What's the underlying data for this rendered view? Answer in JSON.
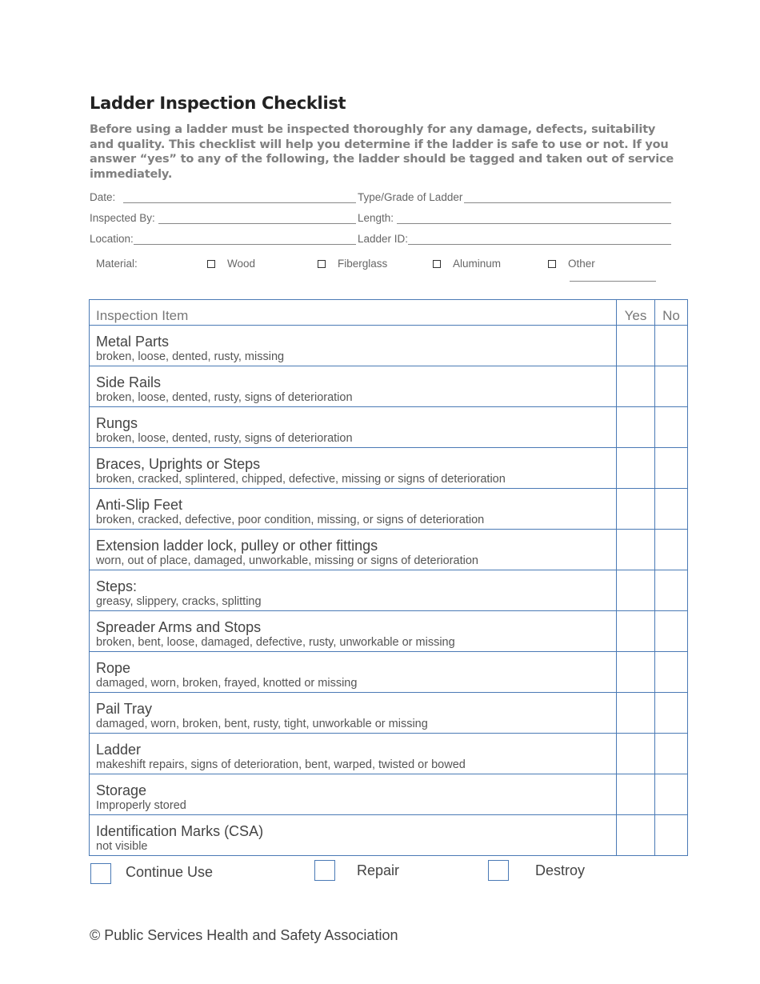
{
  "document": {
    "title": "Ladder Inspection Checklist",
    "intro": "Before using a ladder must be inspected thoroughly for any damage, defects, suitability and quality. This checklist will help you determine if the ladder is safe to use or not. If you answer “yes” to any of the following, the ladder should be tagged and taken out of service immediately."
  },
  "fields": {
    "date": {
      "label": "Date:",
      "value": ""
    },
    "type_grade": {
      "label": "Type/Grade of Ladder",
      "value": ""
    },
    "inspected_by": {
      "label": "Inspected By:",
      "value": ""
    },
    "length": {
      "label": "Length:",
      "value": ""
    },
    "location": {
      "label": "Location:",
      "value": ""
    },
    "ladder_id": {
      "label": "Ladder ID:",
      "value": ""
    }
  },
  "material": {
    "label": "Material:",
    "options": [
      {
        "label": "Wood",
        "checked": false
      },
      {
        "label": "Fiberglass",
        "checked": false
      },
      {
        "label": "Aluminum",
        "checked": false
      },
      {
        "label": "Other",
        "checked": false
      }
    ]
  },
  "table": {
    "headers": {
      "item": "Inspection Item",
      "yes": "Yes",
      "no": "No"
    },
    "rows": [
      {
        "name": "Metal Parts",
        "desc": "broken, loose, dented, rusty, missing"
      },
      {
        "name": "Side Rails",
        "desc": "broken, loose, dented, rusty, signs of deterioration"
      },
      {
        "name": "Rungs",
        "desc": "broken, loose, dented, rusty, signs of deterioration"
      },
      {
        "name": "Braces, Uprights or Steps",
        "desc": "broken, cracked, splintered, chipped, defective, missing or signs of deterioration"
      },
      {
        "name": "Anti-Slip Feet",
        "desc": "broken, cracked, defective, poor condition, missing, or signs of deterioration"
      },
      {
        "name": "Extension ladder lock, pulley or other fittings",
        "desc": "worn, out of place, damaged, unworkable, missing or signs of deterioration"
      },
      {
        "name": "Steps:",
        "desc": "greasy, slippery, cracks, splitting"
      },
      {
        "name": "Spreader Arms and Stops",
        "desc": "broken, bent, loose, damaged, defective, rusty, unworkable or missing"
      },
      {
        "name": "Rope",
        "desc": "damaged, worn, broken, frayed, knotted or missing"
      },
      {
        "name": "Pail Tray",
        "desc": "damaged, worn, broken, bent, rusty, tight, unworkable or missing"
      },
      {
        "name": "Ladder",
        "desc": "makeshift repairs, signs of deterioration, bent, warped, twisted or bowed"
      },
      {
        "name": "Storage",
        "desc": "Improperly stored"
      },
      {
        "name": "Identification Marks (CSA)",
        "desc": "not visible"
      }
    ]
  },
  "outcomes": [
    {
      "label": "Continue Use",
      "checked": false
    },
    {
      "label": "Repair",
      "checked": false
    },
    {
      "label": "Destroy",
      "checked": false
    }
  ],
  "footer": "© Public Services Health and Safety Association",
  "colors": {
    "table_border": "#4a7ab5",
    "intro_text": "#808080"
  }
}
